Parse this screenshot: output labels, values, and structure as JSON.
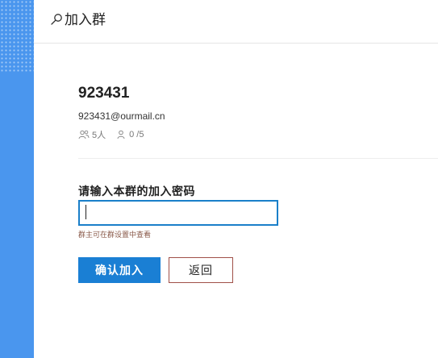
{
  "header": {
    "title": "加入群",
    "icon": "search-icon"
  },
  "group": {
    "name": "923431",
    "email": "923431@ourmail.cn",
    "member_count": "5人",
    "online_count": "0 /5"
  },
  "form": {
    "password_label": "请输入本群的加入密码",
    "password_value": "",
    "password_hint": "群主可在群设置中查看"
  },
  "actions": {
    "confirm_label": "确认加入",
    "back_label": "返回"
  },
  "colors": {
    "sidebar": "#4a96ee",
    "accent": "#1a7fd4",
    "back_border": "#a05048"
  }
}
